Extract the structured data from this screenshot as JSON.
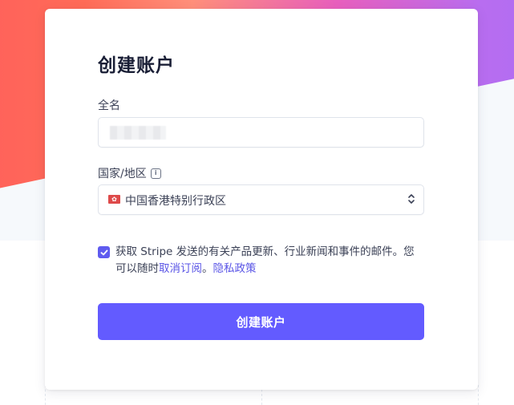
{
  "page": {
    "title": "创建账户"
  },
  "form": {
    "full_name_label": "全名",
    "full_name_value": "",
    "country_label": "国家/地区",
    "country_info_icon": "info-icon",
    "country_value": "中国香港特别行政区",
    "country_flag_icon": "hong-kong-flag-icon",
    "consent_checked": true,
    "consent_text_main": "获取 Stripe 发送的有关产品更新、行业新闻和事件的邮件。您可以随时",
    "unsubscribe_link": "取消订阅",
    "separator": "。",
    "privacy_link": "隐私政策",
    "submit_label": "创建账户"
  },
  "colors": {
    "accent": "#635bff",
    "link": "#5a55e6",
    "text_dark": "#1a1f36",
    "text": "#3c4257",
    "gradient_start": "#ff5a5f",
    "gradient_end": "#a66cf4"
  }
}
